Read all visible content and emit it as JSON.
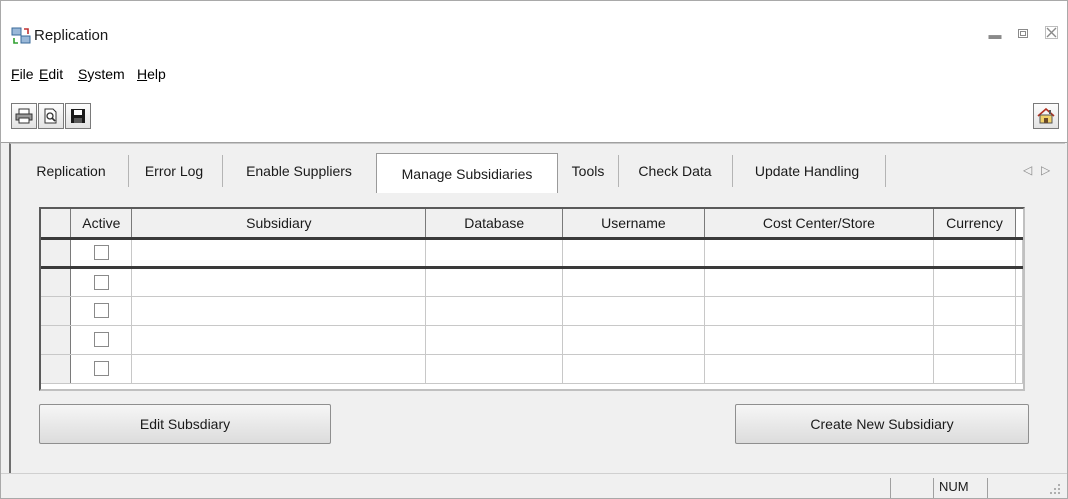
{
  "window": {
    "title": "Replication",
    "controls": [
      "minimize-icon",
      "restore-icon",
      "close-icon"
    ]
  },
  "menu": [
    {
      "label": "File",
      "accel": "F",
      "rest": "ile"
    },
    {
      "label": "Edit",
      "accel": "E",
      "rest": "dit"
    },
    {
      "label": "System",
      "accel": "S",
      "rest": "ystem"
    },
    {
      "label": "Help",
      "accel": "H",
      "rest": "elp"
    }
  ],
  "toolbar": {
    "buttons": [
      "print-icon",
      "print-preview-icon",
      "save-icon"
    ],
    "right_button": "home-icon"
  },
  "tabs": [
    {
      "label": "Replication",
      "active": false
    },
    {
      "label": "Error Log",
      "active": false
    },
    {
      "label": "Enable Suppliers",
      "active": false
    },
    {
      "label": "Manage Subsidiaries",
      "active": true
    },
    {
      "label": "Tools",
      "active": false
    },
    {
      "label": "Check Data",
      "active": false
    },
    {
      "label": "Update Handling",
      "active": false
    }
  ],
  "grid": {
    "columns": [
      "Active",
      "Subsidiary",
      "Database",
      "Username",
      "Cost Center/Store",
      "Currency"
    ],
    "rows": [
      {
        "active": false,
        "subsidiary": "",
        "database": "",
        "username": "",
        "cost_center": "",
        "currency": ""
      },
      {
        "active": false,
        "subsidiary": "",
        "database": "",
        "username": "",
        "cost_center": "",
        "currency": ""
      },
      {
        "active": false,
        "subsidiary": "",
        "database": "",
        "username": "",
        "cost_center": "",
        "currency": ""
      },
      {
        "active": false,
        "subsidiary": "",
        "database": "",
        "username": "",
        "cost_center": "",
        "currency": ""
      },
      {
        "active": false,
        "subsidiary": "",
        "database": "",
        "username": "",
        "cost_center": "",
        "currency": ""
      }
    ]
  },
  "buttons": {
    "edit": "Edit Subsdiary",
    "create": "Create New Subsidiary"
  },
  "status": {
    "num": "NUM"
  }
}
